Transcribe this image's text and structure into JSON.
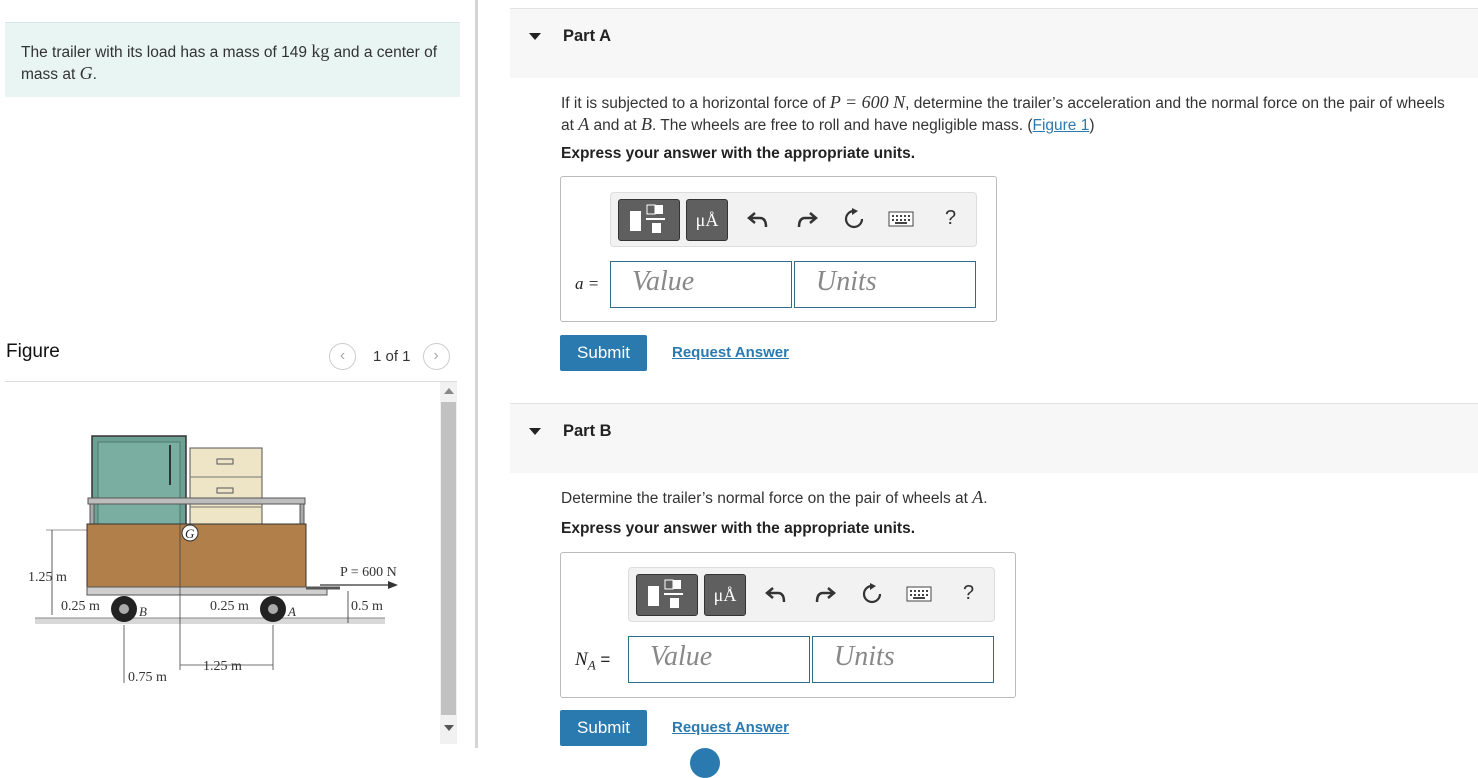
{
  "intro": {
    "text_before": "The trailer with its load has a mass of 149 ",
    "mass_unit": "kg",
    "text_middle": " and a center of mass at ",
    "com_var": "G",
    "text_end": "."
  },
  "figure_panel": {
    "title": "Figure",
    "count": "1 of 1",
    "prev_icon": "chevron-left-icon",
    "next_icon": "chevron-right-icon",
    "labels": {
      "height": "1.25 m",
      "wheel_offset_left": "0.25 m",
      "wheel_offset_right": "0.25 m",
      "point_b": "B",
      "point_a": "A",
      "point_g": "G",
      "force": "P = 600 N",
      "force_height": "0.5 m",
      "dist_b": "0.75 m",
      "dist_a": "1.25 m"
    }
  },
  "part_a": {
    "label": "Part A",
    "q_before": "If it is subjected to a horizontal force of ",
    "q_force": "P = 600 N",
    "q_mid1": ", determine the trailer’s acceleration and the normal force on the pair of wheels at ",
    "q_a": "A",
    "q_mid2": " and at ",
    "q_b": "B",
    "q_mid3": ". The wheels are free to roll and have negligible mass. (",
    "q_link": "Figure 1",
    "q_end": ")",
    "express": "Express your answer with the appropriate units.",
    "var_label": "a =",
    "value_placeholder": "Value",
    "units_placeholder": "Units",
    "submit": "Submit",
    "request": "Request Answer"
  },
  "part_b": {
    "label": "Part B",
    "q_before": "Determine the trailer’s normal force on the pair of wheels at ",
    "q_a": "A",
    "q_end": ".",
    "express": "Express your answer with the appropriate units.",
    "var_main": "N",
    "var_sub": "A",
    "var_eq": " =",
    "value_placeholder": "Value",
    "units_placeholder": "Units",
    "submit": "Submit",
    "request": "Request Answer"
  },
  "toolbar": {
    "mu_label": "μÅ",
    "help": "?",
    "icons": [
      "templates-icon",
      "units-icon",
      "undo-icon",
      "redo-icon",
      "reset-icon",
      "keyboard-icon",
      "help-icon"
    ]
  }
}
